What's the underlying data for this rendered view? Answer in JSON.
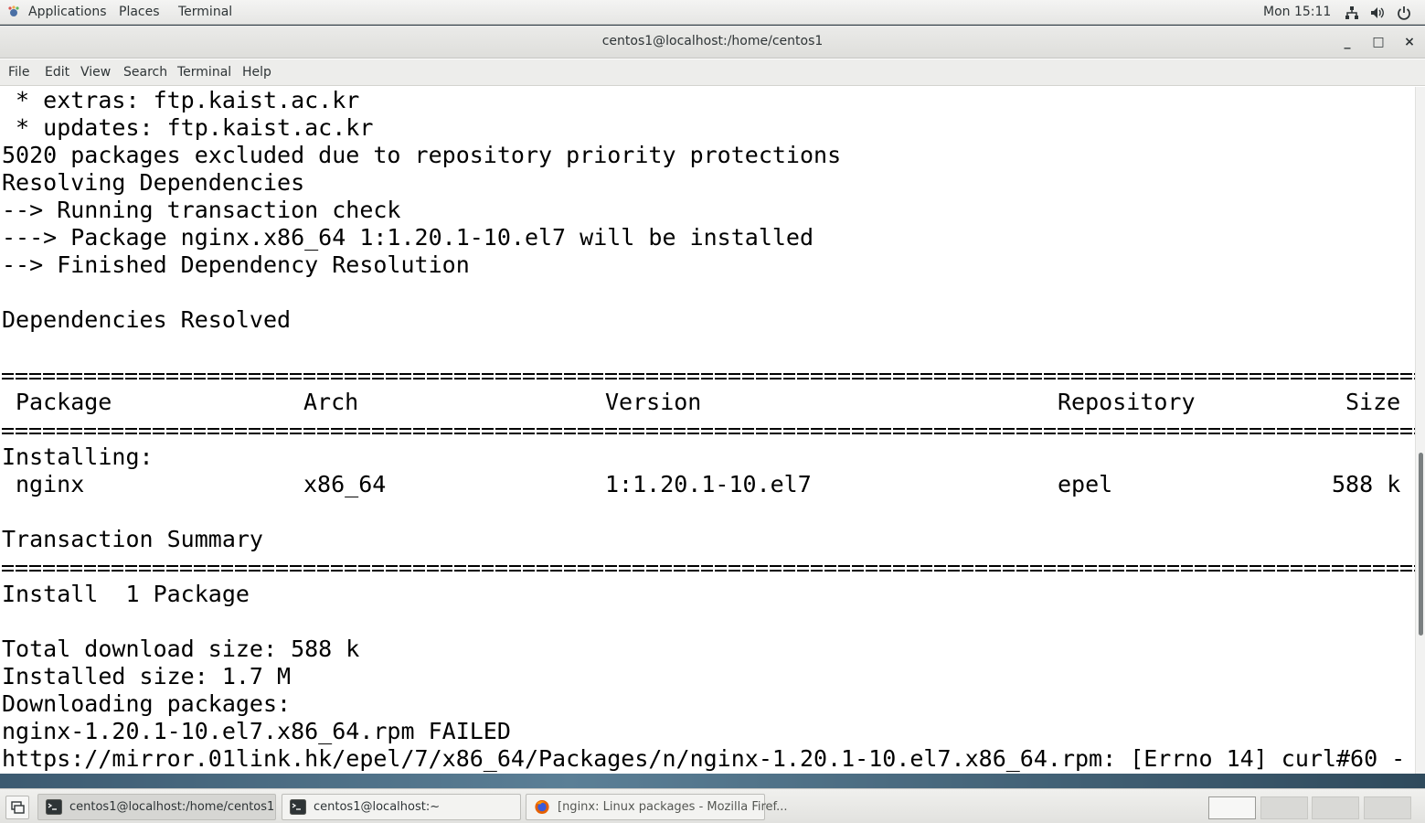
{
  "top_panel": {
    "applications": "Applications",
    "places": "Places",
    "terminal": "Terminal",
    "clock": "Mon 15:11",
    "tray_icons": [
      "network-icon",
      "volume-icon",
      "power-icon"
    ]
  },
  "window": {
    "title": "centos1@localhost:/home/centos1",
    "controls": {
      "minimize": "_",
      "maximize": "□",
      "close": "×"
    }
  },
  "menubar": [
    "File",
    "Edit",
    "View",
    "Search",
    "Terminal",
    "Help"
  ],
  "terminal": {
    "lines": [
      " * extras: ftp.kaist.ac.kr",
      " * updates: ftp.kaist.ac.kr",
      "5020 packages excluded due to repository priority protections",
      "Resolving Dependencies",
      "--> Running transaction check",
      "---> Package nginx.x86_64 1:1.20.1-10.el7 will be installed",
      "--> Finished Dependency Resolution",
      "",
      "Dependencies Resolved",
      ""
    ],
    "table_header": {
      "package": "Package",
      "arch": "Arch",
      "version": "Version",
      "repository": "Repository",
      "size": "Size"
    },
    "installing_label": "Installing:",
    "table_row": {
      "package": "nginx",
      "arch": "x86_64",
      "version": "1:1.20.1-10.el7",
      "repository": "epel",
      "size": "588 k"
    },
    "summary_title": "Transaction Summary",
    "tail_lines": [
      "Install  1 Package",
      "",
      "Total download size: 588 k",
      "Installed size: 1.7 M",
      "Downloading packages:",
      "nginx-1.20.1-10.el7.x86_64.rpm FAILED",
      "https://mirror.01link.hk/epel/7/x86_64/Packages/n/nginx-1.20.1-10.el7.x86_64.rpm: [Errno 14] curl#60 -"
    ]
  },
  "taskbar": {
    "tasks": [
      {
        "label": "centos1@localhost:/home/centos1",
        "icon": "terminal-icon",
        "active": true
      },
      {
        "label": "centos1@localhost:~",
        "icon": "terminal-icon",
        "active": false
      },
      {
        "label": "[nginx: Linux packages - Mozilla Firef...",
        "icon": "firefox-icon",
        "active": false
      }
    ],
    "workspaces": 4
  },
  "colors": {
    "terminal_bg": "#ffffff",
    "terminal_fg": "#000000",
    "panel_bg": "#e6e6e4"
  }
}
